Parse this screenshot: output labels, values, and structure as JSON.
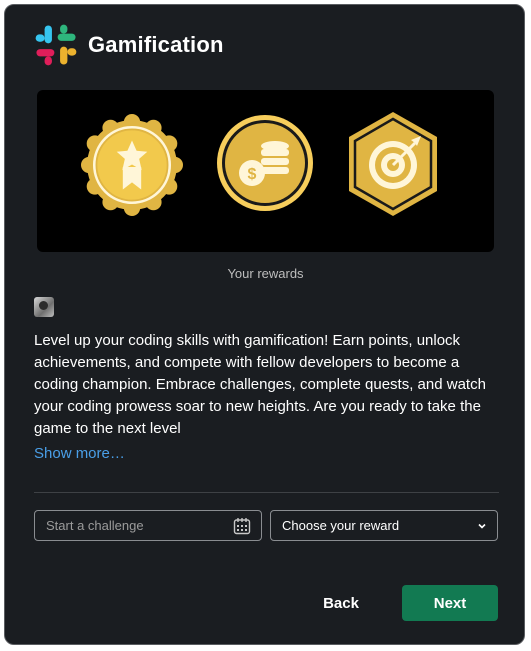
{
  "app": {
    "title": "Gamification"
  },
  "banner": {
    "caption": "Your rewards"
  },
  "description": "Level up your coding skills with gamification! Earn points, unlock achievements, and compete with fellow developers to become a coding champion. Embrace challenges, complete quests, and watch your coding prowess soar to new heights. Are you ready to take the game to the next level",
  "show_more_label": "Show more…",
  "challenge_field": {
    "placeholder": "Start a challenge",
    "icon": "calendar-icon"
  },
  "reward_select": {
    "value": "Choose your reward",
    "icon": "chevron-down-icon"
  },
  "actions": {
    "back_label": "Back",
    "next_label": "Next"
  },
  "colors": {
    "background": "#1a1d21",
    "accent": "#127a52",
    "link": "#4a9fe8",
    "badge_gold": "#e0b543",
    "badge_light": "#f7ce5c"
  }
}
